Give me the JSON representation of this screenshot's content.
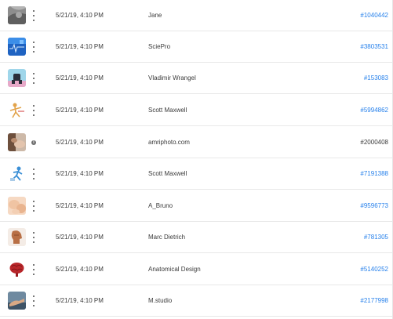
{
  "rows": [
    {
      "thumb": "gray-abstract-thumbnail",
      "date": "5/21/19, 4:10 PM",
      "contributor": "Jane",
      "id": "#1040442",
      "id_link": true,
      "action": "more"
    },
    {
      "thumb": "blue-medical-scan-thumbnail",
      "date": "5/21/19, 4:10 PM",
      "contributor": "SciePro",
      "id": "#3803531",
      "id_link": true,
      "action": "more"
    },
    {
      "thumb": "robot-figure-thumbnail",
      "date": "5/21/19, 4:10 PM",
      "contributor": "Vladimir Wrangel",
      "id": "#153083",
      "id_link": true,
      "action": "more"
    },
    {
      "thumb": "skeleton-pose-thumbnail",
      "date": "5/21/19, 4:10 PM",
      "contributor": "Scott Maxwell",
      "id": "#5994862",
      "id_link": true,
      "action": "more"
    },
    {
      "thumb": "massage-photo-thumbnail",
      "date": "5/21/19, 4:10 PM",
      "contributor": "amriphoto.com",
      "id": "#2000408",
      "id_link": false,
      "action": "info"
    },
    {
      "thumb": "blue-figure-thumbnail",
      "date": "5/21/19, 4:10 PM",
      "contributor": "Scott Maxwell",
      "id": "#7191388",
      "id_link": true,
      "action": "more"
    },
    {
      "thumb": "skin-closeup-thumbnail",
      "date": "5/21/19, 4:10 PM",
      "contributor": "A_Bruno",
      "id": "#9596773",
      "id_link": true,
      "action": "more"
    },
    {
      "thumb": "anatomy-head-thumbnail",
      "date": "5/21/19, 4:10 PM",
      "contributor": "Marc Dietrich",
      "id": "#781305",
      "id_link": true,
      "action": "more"
    },
    {
      "thumb": "brain-model-thumbnail",
      "date": "5/21/19, 4:10 PM",
      "contributor": "Anatomical Design",
      "id": "#5140252",
      "id_link": true,
      "action": "more"
    },
    {
      "thumb": "hand-photo-thumbnail",
      "date": "5/21/19, 4:10 PM",
      "contributor": "M.studio",
      "id": "#2177998",
      "id_link": true,
      "action": "more"
    }
  ],
  "colors": {
    "link": "#2680eb",
    "text": "#3a3a3a",
    "divider": "#e8e8e8"
  }
}
